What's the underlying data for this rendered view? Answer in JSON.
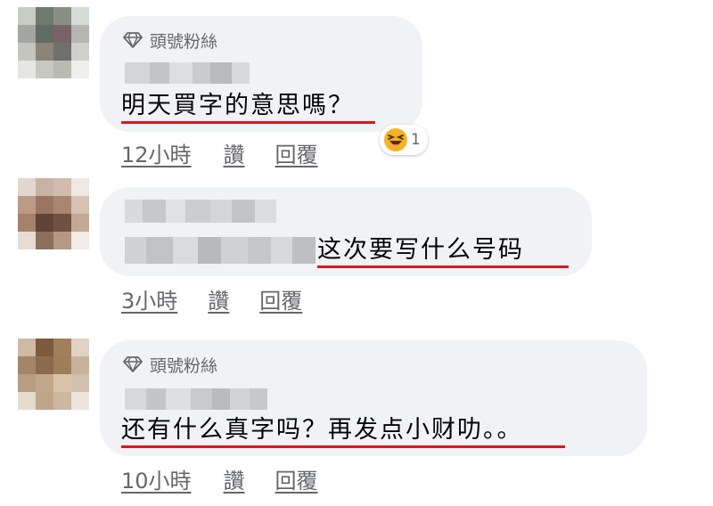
{
  "comments": [
    {
      "badge": "頭號粉絲",
      "text": "明天買字的意思嗎？",
      "actions": {
        "time": "12小時",
        "like": "讚",
        "reply": "回覆"
      },
      "reaction": {
        "icon": "laughing-emoji",
        "count": "1"
      }
    },
    {
      "text": "这次要写什么号码",
      "actions": {
        "time": "3小時",
        "like": "讚",
        "reply": "回覆"
      }
    },
    {
      "badge": "頭號粉絲",
      "text": "还有什么真字吗？再发点小财叻。。",
      "actions": {
        "time": "10小時",
        "like": "讚",
        "reply": "回覆"
      }
    }
  ],
  "colors": {
    "bubble": "#f0f2f5",
    "meta_text": "#65676b",
    "underline": "#e0151b",
    "reaction_face": "#f7b125"
  }
}
